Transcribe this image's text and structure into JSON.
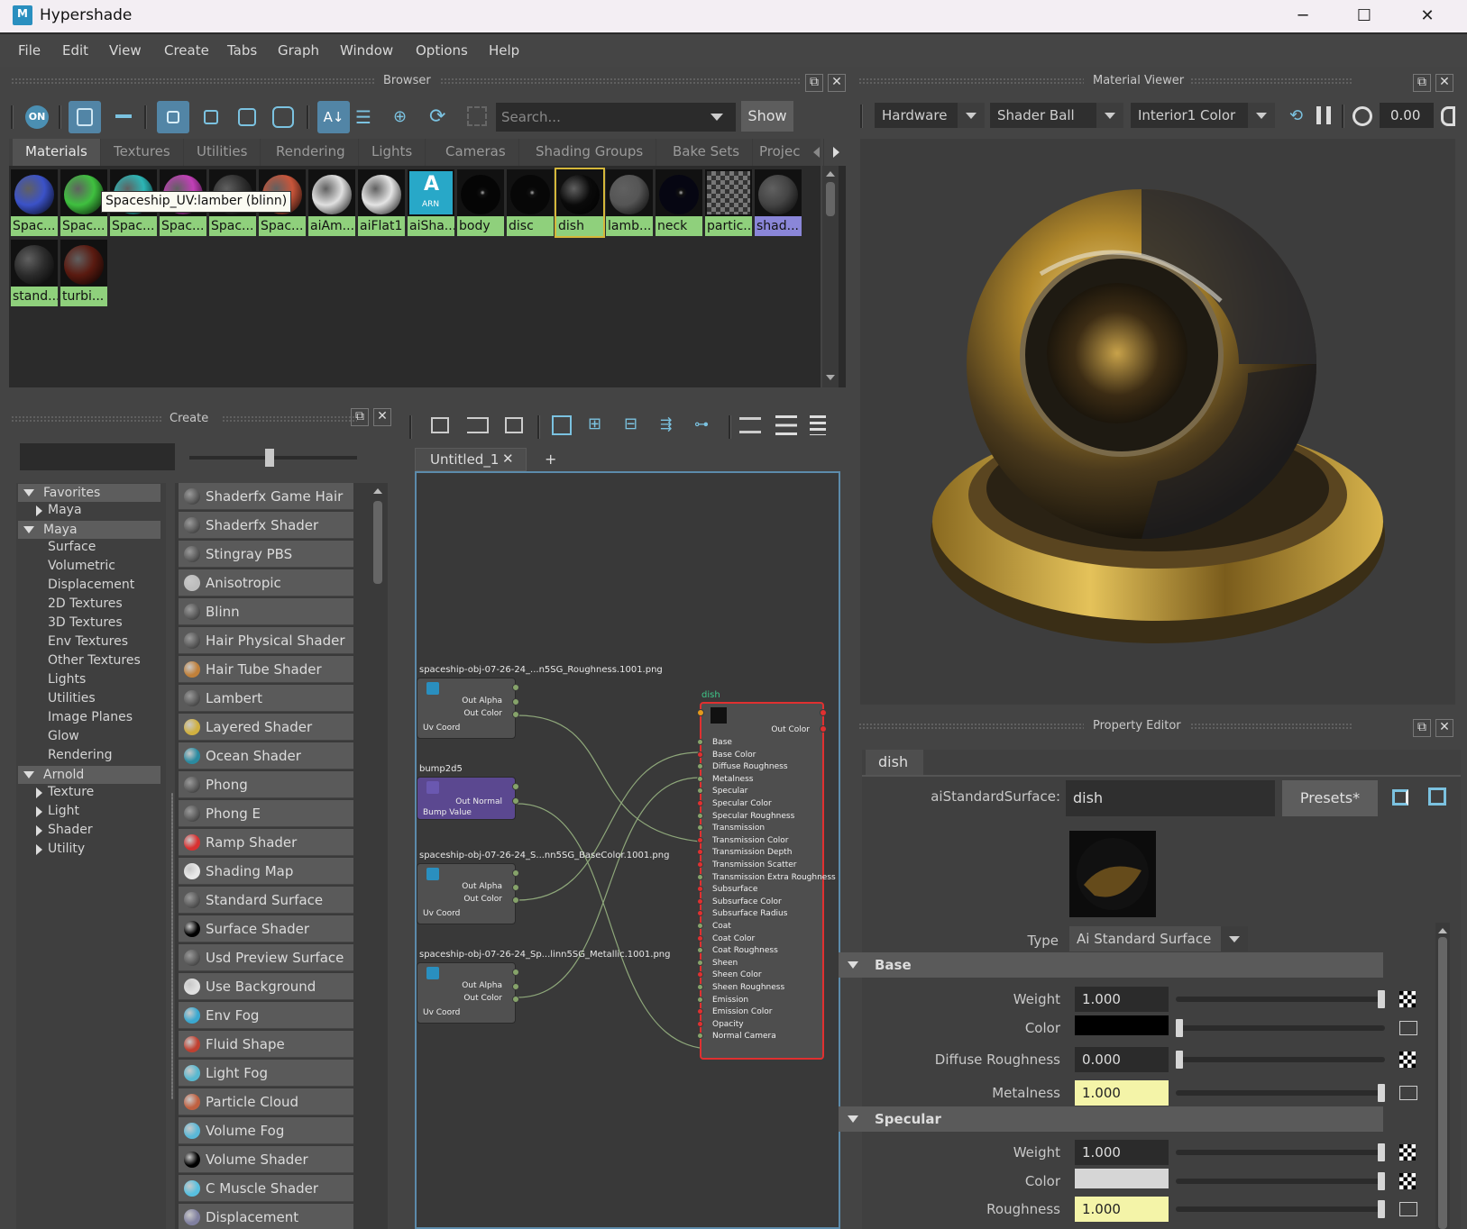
{
  "window": {
    "title": "Hypershade",
    "logo": "M"
  },
  "menubar": [
    "File",
    "Edit",
    "View",
    "Create",
    "Tabs",
    "Graph",
    "Window",
    "Options",
    "Help"
  ],
  "browser": {
    "title": "Browser",
    "on_label": "ON",
    "search_placeholder": "Search...",
    "show_label": "Show",
    "tabs": [
      "Materials",
      "Textures",
      "Utilities",
      "Rendering",
      "Lights",
      "Cameras",
      "Shading Groups",
      "Bake Sets",
      "Projec"
    ],
    "tooltip": "Spaceship_UV:lamber (blinn)",
    "swatches": [
      {
        "label": "Spac...",
        "color": "#3b52c8"
      },
      {
        "label": "Spac...",
        "color": "#3fc03f"
      },
      {
        "label": "Spac...",
        "color": "#2cb6b6"
      },
      {
        "label": "Spac...",
        "color": "#c23fb8"
      },
      {
        "label": "Spac...",
        "color": "#303030"
      },
      {
        "label": "Spac...",
        "color": "#c8553a"
      },
      {
        "label": "aiAm...",
        "color": "#e0e0e0"
      },
      {
        "label": "aiFlat1",
        "color": "#e4e4e4"
      },
      {
        "label": "aiSha...",
        "color": "#28a8c8"
      },
      {
        "label": "body",
        "color": "#050505"
      },
      {
        "label": "disc",
        "color": "#070707"
      },
      {
        "label": "dish",
        "color": "#0a0a0a"
      },
      {
        "label": "lamb...",
        "color": "#555555"
      },
      {
        "label": "neck",
        "color": "#060612"
      },
      {
        "label": "partic...",
        "color": "#208898"
      },
      {
        "label": "shad...",
        "color": "#444444"
      },
      {
        "label": "stand...",
        "color": "#2c2c2c"
      },
      {
        "label": "turbi...",
        "color": "#5a1a10"
      }
    ],
    "aishader_text": "A",
    "aishader_sub": "ARN"
  },
  "create": {
    "title": "Create",
    "tree": {
      "favorites": "Favorites",
      "fav_maya": "Maya",
      "maya": "Maya",
      "maya_items": [
        "Surface",
        "Volumetric",
        "Displacement",
        "2D Textures",
        "3D Textures",
        "Env Textures",
        "Other Textures",
        "Lights",
        "Utilities",
        "Image Planes",
        "Glow",
        "Rendering"
      ],
      "arnold": "Arnold",
      "arnold_items": [
        "Texture",
        "Light",
        "Shader",
        "Utility"
      ]
    },
    "shaders": [
      "Shaderfx Game Hair",
      "Shaderfx Shader",
      "Stingray PBS",
      "Anisotropic",
      "Blinn",
      "Hair Physical Shader",
      "Hair Tube Shader",
      "Lambert",
      "Layered Shader",
      "Ocean Shader",
      "Phong",
      "Phong E",
      "Ramp Shader",
      "Shading Map",
      "Standard Surface",
      "Surface Shader",
      "Usd Preview Surface",
      "Use Background",
      "Env Fog",
      "Fluid Shape",
      "Light Fog",
      "Particle Cloud",
      "Volume Fog",
      "Volume Shader",
      "C Muscle Shader",
      "Displacement"
    ]
  },
  "node_editor": {
    "tab": "Untitled_1",
    "close": "✕",
    "add": "+",
    "nodes": {
      "rough": {
        "title": "spaceship-obj-07-26-24_...n5SG_Roughness.1001.png",
        "out1": "Out Alpha",
        "out2": "Out Color",
        "in1": "Uv Coord"
      },
      "bump": {
        "title": "bump2d5",
        "out1": "Out Normal",
        "in1": "Bump Value"
      },
      "base": {
        "title": "spaceship-obj-07-26-24_S...nn5SG_BaseColor.1001.png",
        "out1": "Out Alpha",
        "out2": "Out Color",
        "in1": "Uv Coord"
      },
      "metal": {
        "title": "spaceship-obj-07-26-24_Sp...linn5SG_Metallic.1001.png",
        "out1": "Out Alpha",
        "out2": "Out Color",
        "in1": "Uv Coord"
      },
      "dish": {
        "title": "dish",
        "out": "Out Color",
        "attrs": [
          "Base",
          "Base Color",
          "Diffuse Roughness",
          "Metalness",
          "Specular",
          "Specular Color",
          "Specular Roughness",
          "Transmission",
          "Transmission Color",
          "Transmission Depth",
          "Transmission Scatter",
          "Transmission Extra Roughness",
          "Subsurface",
          "Subsurface Color",
          "Subsurface Radius",
          "Coat",
          "Coat Color",
          "Coat Roughness",
          "Sheen",
          "Sheen Color",
          "Sheen Roughness",
          "Emission",
          "Emission Color",
          "Opacity",
          "Normal Camera"
        ]
      }
    }
  },
  "viewer": {
    "title": "Material Viewer",
    "renderer": "Hardware",
    "geometry": "Shader Ball",
    "environment": "Interior1 Color",
    "exposure": "0.00"
  },
  "property_editor": {
    "title": "Property Editor",
    "tab": "dish",
    "node_type_label": "aiStandardSurface:",
    "node_name": "dish",
    "presets": "Presets*",
    "type_label": "Type",
    "type_value": "Ai Standard Surface",
    "base_section": "Base",
    "specular_section": "Specular",
    "base": [
      {
        "label": "Weight",
        "value": "1.000",
        "fraction": 1.0
      },
      {
        "label": "Color",
        "value": "",
        "swatch": "#000000",
        "fraction": 0.0
      },
      {
        "label": "Diffuse Roughness",
        "value": "0.000",
        "fraction": 0.0
      },
      {
        "label": "Metalness",
        "value": "1.000",
        "fraction": 1.0
      }
    ],
    "specular": [
      {
        "label": "Weight",
        "value": "1.000",
        "fraction": 1.0
      },
      {
        "label": "Color",
        "value": "",
        "swatch": "#d6d6d6",
        "fraction": 1.0
      },
      {
        "label": "Roughness",
        "value": "1.000",
        "fraction": 1.0
      }
    ]
  },
  "colors": {
    "accent": "#5285a6",
    "material_label": "#8fd07c",
    "highlight_field": "#f4f4a8",
    "node_border_selected": "#e03030"
  }
}
